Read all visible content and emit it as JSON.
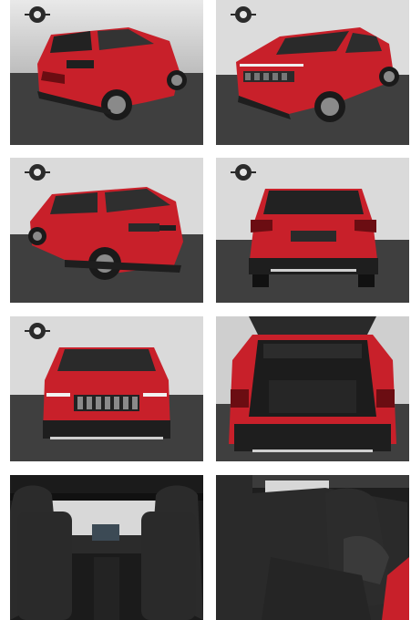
{
  "gallery": {
    "photos": [
      {
        "view": "rear-three-quarter-left"
      },
      {
        "view": "front-three-quarter-left"
      },
      {
        "view": "rear-three-quarter-left-low"
      },
      {
        "view": "rear"
      },
      {
        "view": "front"
      },
      {
        "view": "trunk-open"
      },
      {
        "view": "front-interior-dashboard"
      },
      {
        "view": "rear-seats"
      }
    ],
    "colors": {
      "body_red": "#c8202a",
      "body_red_dark": "#8e1219",
      "studio_wall": "#d9d9d9",
      "studio_floor": "#3f3f3f",
      "upholstery": "#2a2a2a"
    }
  }
}
